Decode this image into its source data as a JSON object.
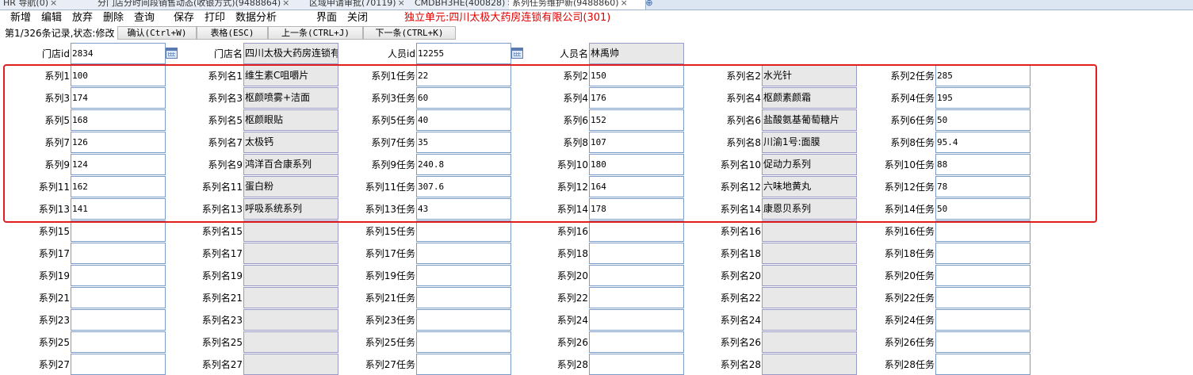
{
  "tabs": [
    {
      "label": "HR 导航(0)"
    },
    {
      "label": "分门店分时间段销售动态(收银方式)(9488864)"
    },
    {
      "label": "区域申请审批(70119)"
    },
    {
      "label": "CMDBH3HE(400828)"
    },
    {
      "label": "系列任务维护新(9488860)"
    }
  ],
  "menu": {
    "new": "新增",
    "edit": "编辑",
    "discard": "放弃",
    "delete": "删除",
    "query": "查询",
    "save": "保存",
    "print": "打印",
    "analysis": "数据分析",
    "ui": "界面",
    "close": "关闭",
    "unit": "独立单元:四川太极大药房连锁有限公司(301)"
  },
  "toolbar": {
    "status": "第1/326条记录,状态:修改",
    "confirm": "确认(Ctrl+W)",
    "table": "表格(ESC)",
    "prev": "上一条(CTRL+J)",
    "next": "下一条(CTRL+K)"
  },
  "header": {
    "store_id_label": "门店id",
    "store_id": "2834",
    "store_name_label": "门店名",
    "store_name": "四川太极大药房连锁有",
    "staff_id_label": "人员id",
    "staff_id": "12255",
    "staff_name_label": "人员名",
    "staff_name": "林禹帅"
  },
  "series": [
    {
      "label": "系列1",
      "value": "100",
      "name_label": "系列名1",
      "name": "维生素C咀嚼片",
      "task_label": "系列1任务",
      "task": "22"
    },
    {
      "label": "系列2",
      "value": "150",
      "name_label": "系列名2",
      "name": "水光针",
      "task_label": "系列2任务",
      "task": "285"
    },
    {
      "label": "系列3",
      "value": "174",
      "name_label": "系列名3",
      "name": "枢颜喷雾+洁面",
      "task_label": "系列3任务",
      "task": "60"
    },
    {
      "label": "系列4",
      "value": "176",
      "name_label": "系列名4",
      "name": "枢颜素颜霜",
      "task_label": "系列4任务",
      "task": "195"
    },
    {
      "label": "系列5",
      "value": "168",
      "name_label": "系列名5",
      "name": "枢颜眼贴",
      "task_label": "系列5任务",
      "task": "40"
    },
    {
      "label": "系列6",
      "value": "152",
      "name_label": "系列名6",
      "name": "盐酸氨基葡萄糖片",
      "task_label": "系列6任务",
      "task": "50"
    },
    {
      "label": "系列7",
      "value": "126",
      "name_label": "系列名7",
      "name": "太极钙",
      "task_label": "系列7任务",
      "task": "35"
    },
    {
      "label": "系列8",
      "value": "107",
      "name_label": "系列名8",
      "name": "川渝1号:面膜",
      "task_label": "系列8任务",
      "task": "95.4"
    },
    {
      "label": "系列9",
      "value": "124",
      "name_label": "系列名9",
      "name": "鸿洋百合康系列",
      "task_label": "系列9任务",
      "task": "240.8"
    },
    {
      "label": "系列10",
      "value": "180",
      "name_label": "系列名10",
      "name": "促动力系列",
      "task_label": "系列10任务",
      "task": "88"
    },
    {
      "label": "系列11",
      "value": "162",
      "name_label": "系列名11",
      "name": "蛋白粉",
      "task_label": "系列11任务",
      "task": "307.6"
    },
    {
      "label": "系列12",
      "value": "164",
      "name_label": "系列名12",
      "name": "六味地黄丸",
      "task_label": "系列12任务",
      "task": "78"
    },
    {
      "label": "系列13",
      "value": "141",
      "name_label": "系列名13",
      "name": "呼吸系统系列",
      "task_label": "系列13任务",
      "task": "43"
    },
    {
      "label": "系列14",
      "value": "178",
      "name_label": "系列名14",
      "name": "康恩贝系列",
      "task_label": "系列14任务",
      "task": "50"
    },
    {
      "label": "系列15",
      "value": "",
      "name_label": "系列名15",
      "name": "",
      "task_label": "系列15任务",
      "task": ""
    },
    {
      "label": "系列16",
      "value": "",
      "name_label": "系列名16",
      "name": "",
      "task_label": "系列16任务",
      "task": ""
    },
    {
      "label": "系列17",
      "value": "",
      "name_label": "系列名17",
      "name": "",
      "task_label": "系列17任务",
      "task": ""
    },
    {
      "label": "系列18",
      "value": "",
      "name_label": "系列名18",
      "name": "",
      "task_label": "系列18任务",
      "task": ""
    },
    {
      "label": "系列19",
      "value": "",
      "name_label": "系列名19",
      "name": "",
      "task_label": "系列19任务",
      "task": ""
    },
    {
      "label": "系列20",
      "value": "",
      "name_label": "系列名20",
      "name": "",
      "task_label": "系列20任务",
      "task": ""
    },
    {
      "label": "系列21",
      "value": "",
      "name_label": "系列名21",
      "name": "",
      "task_label": "系列21任务",
      "task": ""
    },
    {
      "label": "系列22",
      "value": "",
      "name_label": "系列名22",
      "name": "",
      "task_label": "系列22任务",
      "task": ""
    },
    {
      "label": "系列23",
      "value": "",
      "name_label": "系列名23",
      "name": "",
      "task_label": "系列23任务",
      "task": ""
    },
    {
      "label": "系列24",
      "value": "",
      "name_label": "系列名24",
      "name": "",
      "task_label": "系列24任务",
      "task": ""
    },
    {
      "label": "系列25",
      "value": "",
      "name_label": "系列名25",
      "name": "",
      "task_label": "系列25任务",
      "task": ""
    },
    {
      "label": "系列26",
      "value": "",
      "name_label": "系列名26",
      "name": "",
      "task_label": "系列26任务",
      "task": ""
    },
    {
      "label": "系列27",
      "value": "",
      "name_label": "系列名27",
      "name": "",
      "task_label": "系列27任务",
      "task": ""
    },
    {
      "label": "系列28",
      "value": "",
      "name_label": "系列名28",
      "name": "",
      "task_label": "系列28任务",
      "task": ""
    }
  ]
}
